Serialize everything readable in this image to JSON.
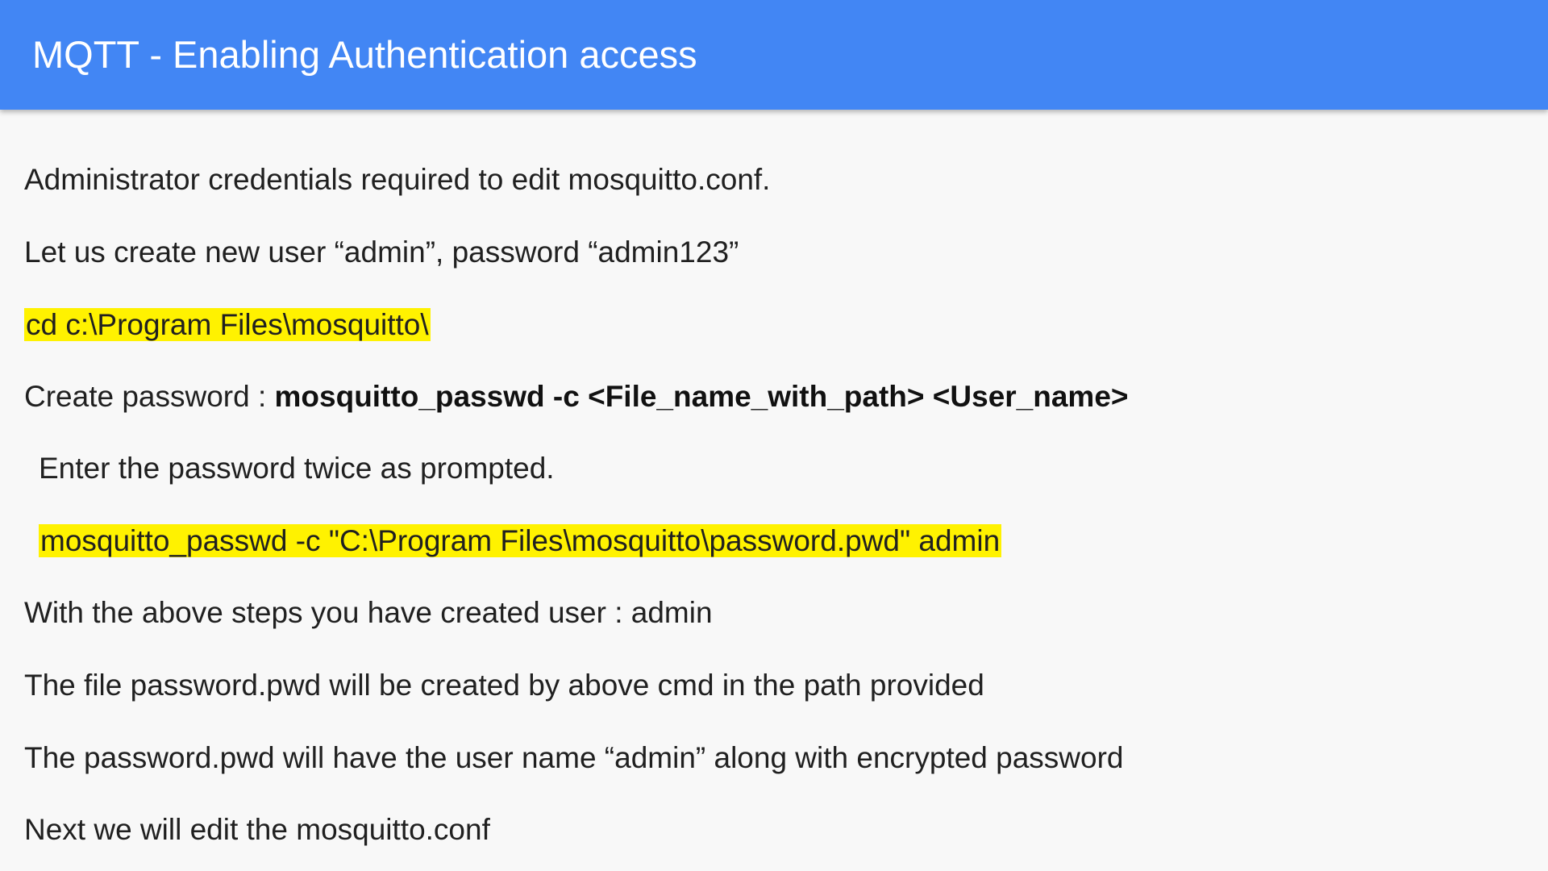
{
  "header": {
    "title": "MQTT - Enabling Authentication access",
    "background_color": "#4286f4"
  },
  "highlight_color": "#fff200",
  "lines": {
    "admin_credentials": "Administrator credentials required to edit mosquitto.conf.",
    "create_user": "Let us create new user “admin”, password “admin123”",
    "cd_command": "cd c:\\Program Files\\mosquitto\\",
    "create_password_label": "Create password : ",
    "create_password_command": "mosquitto_passwd -c <File_name_with_path> <User_name>",
    "enter_password": "Enter the password twice as prompted.",
    "passwd_command": "mosquitto_passwd -c \"C:\\Program Files\\mosquitto\\password.pwd\" admin",
    "created_user": "With the above steps you have created user : admin",
    "file_created": "The file password.pwd will be created by above cmd in the path provided",
    "file_contents": "The password.pwd will have the user name “admin” along with encrypted password",
    "next_step": "Next we will edit the mosquitto.conf"
  }
}
